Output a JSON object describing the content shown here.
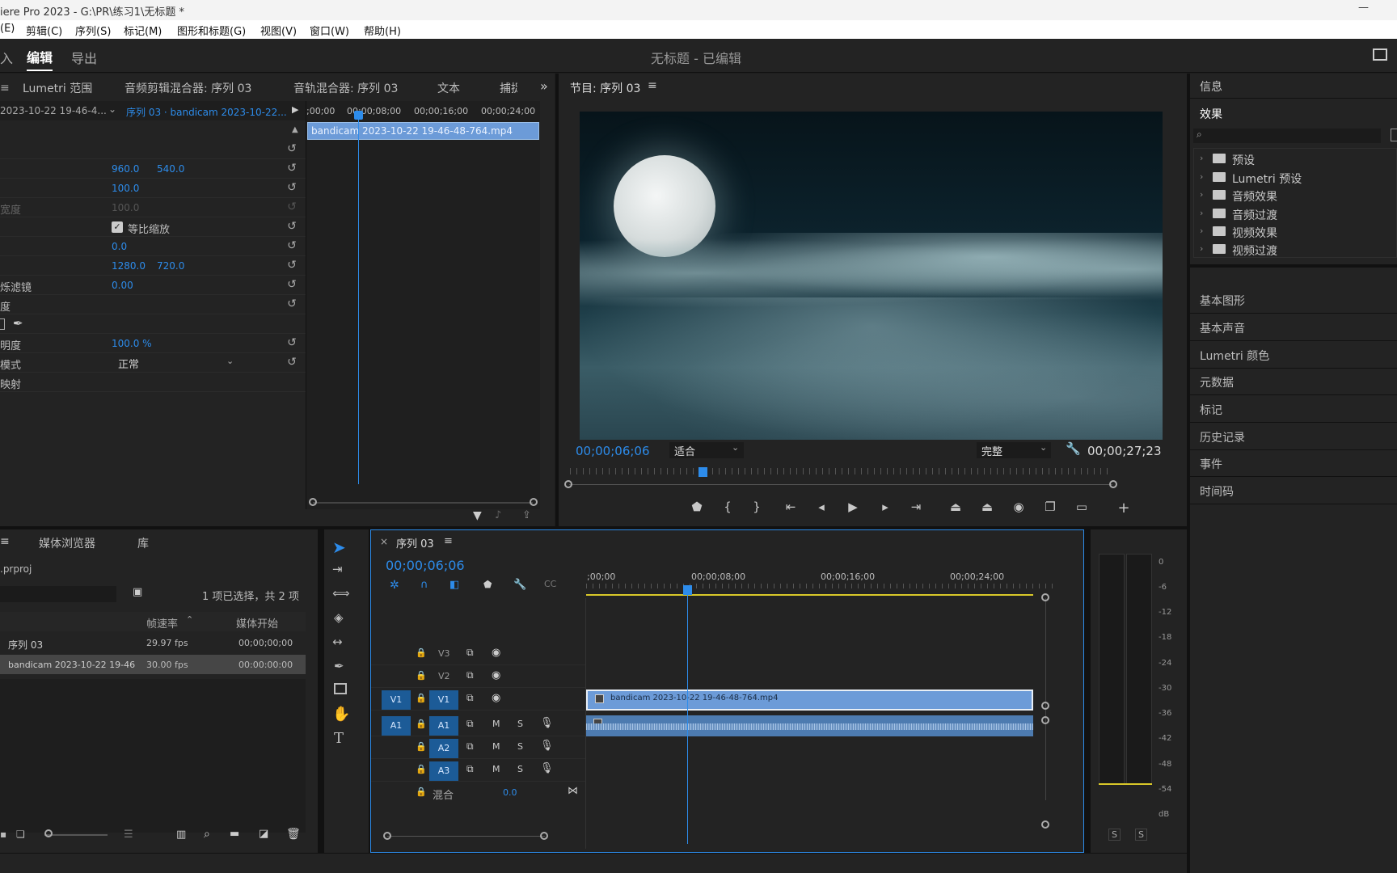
{
  "titlebar": {
    "title": "iere Pro 2023 - G:\\PR\\练习1\\无标题 *",
    "min": "—"
  },
  "menu": [
    "(E)",
    "剪辑(C)",
    "序列(S)",
    "标记(M)",
    "图形和标题(G)",
    "视图(V)",
    "窗口(W)",
    "帮助(H)"
  ],
  "workspace": {
    "tabs": [
      "入",
      "编辑",
      "导出"
    ],
    "title": "无标题 - 已编辑"
  },
  "effect_controls": {
    "tabs": [
      "Lumetri 范围",
      "音频剪辑混合器: 序列 03",
      "音轨混合器: 序列 03",
      "文本",
      "捕捉"
    ],
    "source": "2023-10-22 19-46-4...",
    "sequence": "序列 03 · bandicam 2023-10-22...",
    "rows": [
      {
        "label": "",
        "v1": "960.0",
        "v2": "540.0"
      },
      {
        "label": "",
        "v1": "100.0",
        "v2": ""
      },
      {
        "label": "宽度",
        "v1": "100.0",
        "v2": ""
      },
      {
        "label": "",
        "v1": "等比缩放",
        "v2": ""
      },
      {
        "label": "",
        "v1": "0.0",
        "v2": ""
      },
      {
        "label": "",
        "v1": "1280.0",
        "v2": "720.0"
      },
      {
        "label": "烁滤镜",
        "v1": "0.00",
        "v2": ""
      },
      {
        "label": "度",
        "v1": "",
        "v2": ""
      },
      {
        "label": "",
        "v1": "",
        "v2": ""
      },
      {
        "label": "明度",
        "v1": "100.0 %",
        "v2": ""
      },
      {
        "label": "模式",
        "v1": "正常",
        "v2": ""
      },
      {
        "label": "映射",
        "v1": "",
        "v2": ""
      }
    ],
    "mini_ruler": [
      ";00;00",
      "00;00;08;00",
      "00;00;16;00",
      "00;00;24;00"
    ],
    "clip_name": "bandicam 2023-10-22 19-46-48-764.mp4"
  },
  "program": {
    "title": "节目: 序列 03",
    "timecode": "00;00;06;06",
    "fit": "适合",
    "quality": "完整",
    "duration": "00;00;27;23"
  },
  "right_panel": {
    "info": "信息",
    "effects": "效果",
    "tree": [
      "预设",
      "Lumetri 预设",
      "音频效果",
      "音频过渡",
      "视频效果",
      "视频过渡"
    ],
    "sections": [
      "基本图形",
      "基本声音",
      "Lumetri 颜色",
      "元数据",
      "标记",
      "历史记录",
      "事件",
      "时间码"
    ]
  },
  "project": {
    "tabs": [
      "媒体浏览器",
      "库"
    ],
    "file": ".prproj",
    "selection": "1 项已选择，共 2 项",
    "headers": [
      "帧速率",
      "媒体开始"
    ],
    "items": [
      {
        "name": "序列 03",
        "fps": "29.97 fps",
        "start": "00;00;00;00"
      },
      {
        "name": "bandicam 2023-10-22 19-46",
        "fps": "30.00 fps",
        "start": "00:00:00:00"
      }
    ]
  },
  "timeline": {
    "title": "序列 03",
    "timecode": "00;00;06;06",
    "ruler": [
      ";00;00",
      "00;00;08;00",
      "00;00;16;00",
      "00;00;24;00"
    ],
    "video_tracks": [
      "V3",
      "V2",
      "V1"
    ],
    "audio_tracks": [
      "A1",
      "A2",
      "A3"
    ],
    "src_v": "V1",
    "src_a": "A1",
    "mix_label": "混合",
    "mix_value": "0.0",
    "clip": "bandicam 2023-10-22 19-46-48-764.mp4"
  },
  "meter": {
    "scale": [
      "0",
      "-6",
      "-12",
      "-18",
      "-24",
      "-30",
      "-36",
      "-42",
      "-48",
      "-54",
      "dB"
    ],
    "solo": [
      "S",
      "S"
    ]
  }
}
